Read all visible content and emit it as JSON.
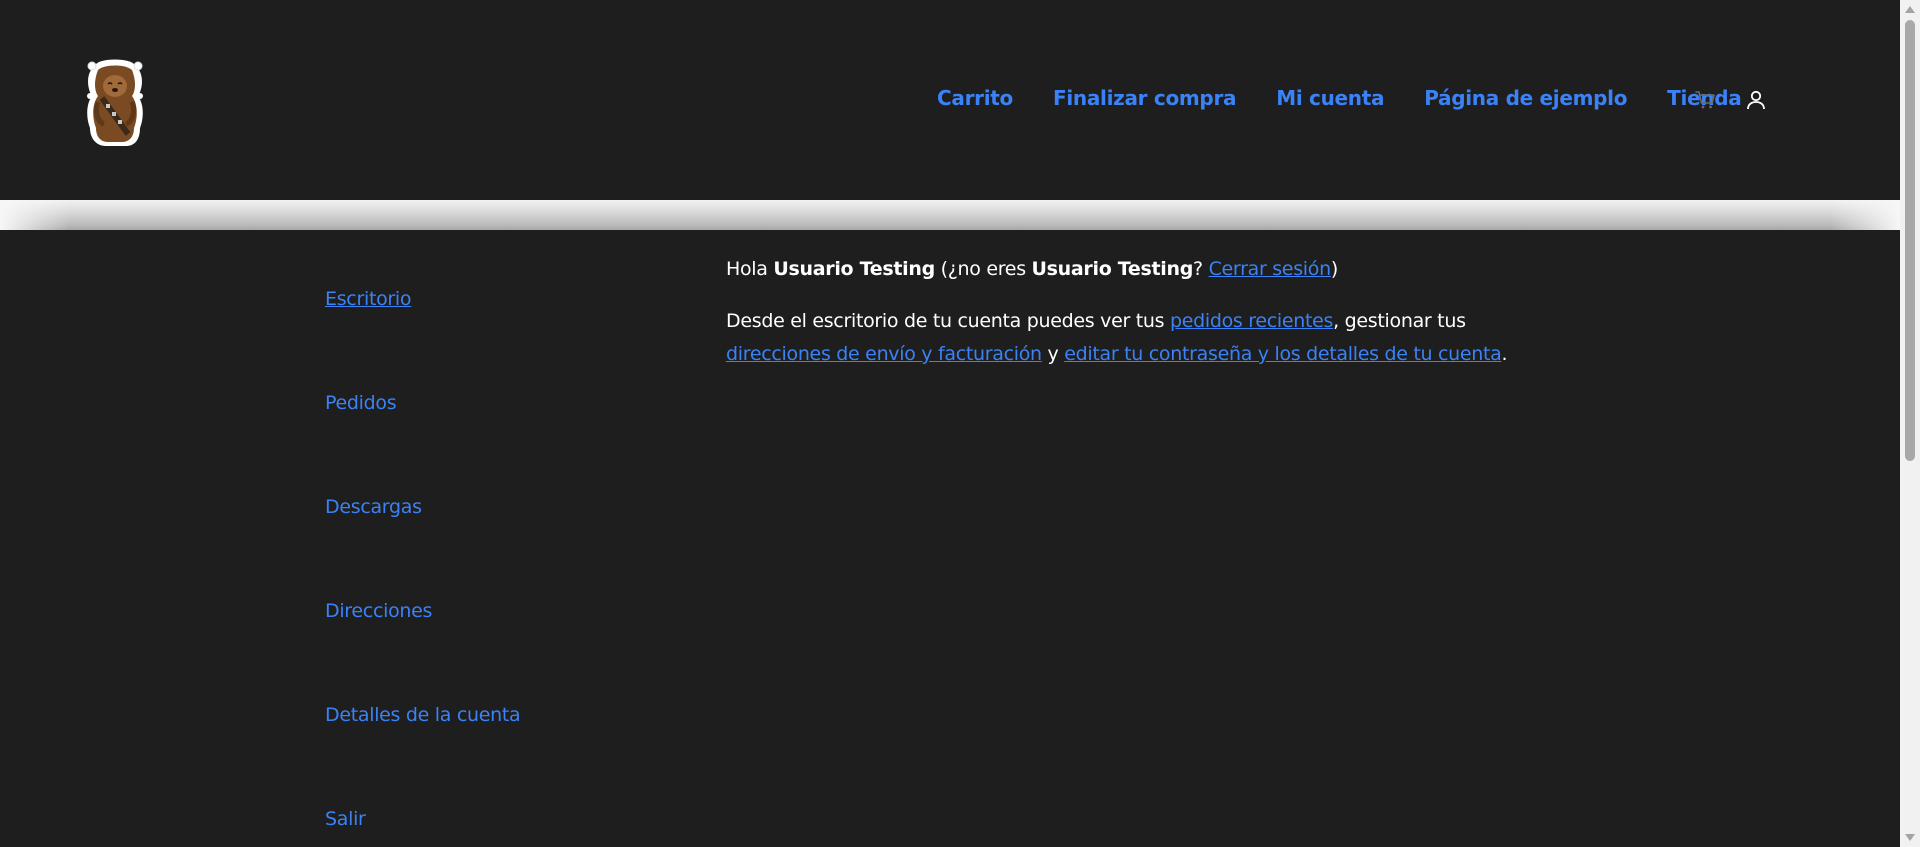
{
  "header": {
    "logo_alt": "Chewbacca logo",
    "nav": [
      {
        "label": "Carrito"
      },
      {
        "label": "Finalizar compra"
      },
      {
        "label": "Mi cuenta"
      },
      {
        "label": "Página de ejemplo"
      },
      {
        "label": "Tienda"
      }
    ],
    "icons": {
      "cart": "cart-icon",
      "account": "user-icon"
    }
  },
  "account_nav": {
    "items": [
      {
        "label": "Escritorio",
        "active": true
      },
      {
        "label": "Pedidos",
        "active": false
      },
      {
        "label": "Descargas",
        "active": false
      },
      {
        "label": "Direcciones",
        "active": false
      },
      {
        "label": "Detalles de la cuenta",
        "active": false
      },
      {
        "label": "Salir",
        "active": false
      }
    ]
  },
  "content": {
    "greeting_prefix": "Hola ",
    "username": "Usuario Testing",
    "greeting_mid": " (¿no eres ",
    "username_2": "Usuario Testing",
    "greeting_q": "? ",
    "logout_link": "Cerrar sesión",
    "greeting_suffix": ")",
    "desc_prefix": "Desde el escritorio de tu cuenta puedes ver tus ",
    "orders_link": "pedidos recientes",
    "desc_mid1": ", gestionar tus ",
    "addresses_link": "direcciones de envío y facturación",
    "desc_mid2": " y ",
    "account_link": "editar tu contraseña y los detalles de tu cuenta",
    "desc_suffix": "."
  },
  "colors": {
    "background": "#1e1e1e",
    "link": "#3b82f6",
    "text": "#ffffff"
  }
}
